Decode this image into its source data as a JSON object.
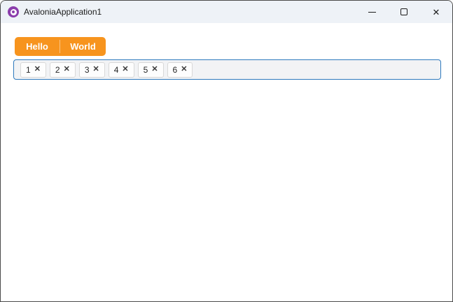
{
  "window": {
    "title": "AvaloniaApplication1",
    "controls": {
      "close_glyph": "✕"
    }
  },
  "segmented_button": {
    "items": [
      {
        "label": "Hello"
      },
      {
        "label": "World"
      }
    ]
  },
  "tag_input": {
    "chips": [
      {
        "label": "1"
      },
      {
        "label": "2"
      },
      {
        "label": "3"
      },
      {
        "label": "4"
      },
      {
        "label": "5"
      },
      {
        "label": "6"
      }
    ],
    "remove_glyph": "✕"
  },
  "colors": {
    "accent_orange": "#F7941E",
    "focus_border_blue": "#2E79BD",
    "titlebar_bg": "#EEF2F7",
    "logo_purple": "#8B3DAC",
    "field_bg": "#F2F3F5"
  }
}
